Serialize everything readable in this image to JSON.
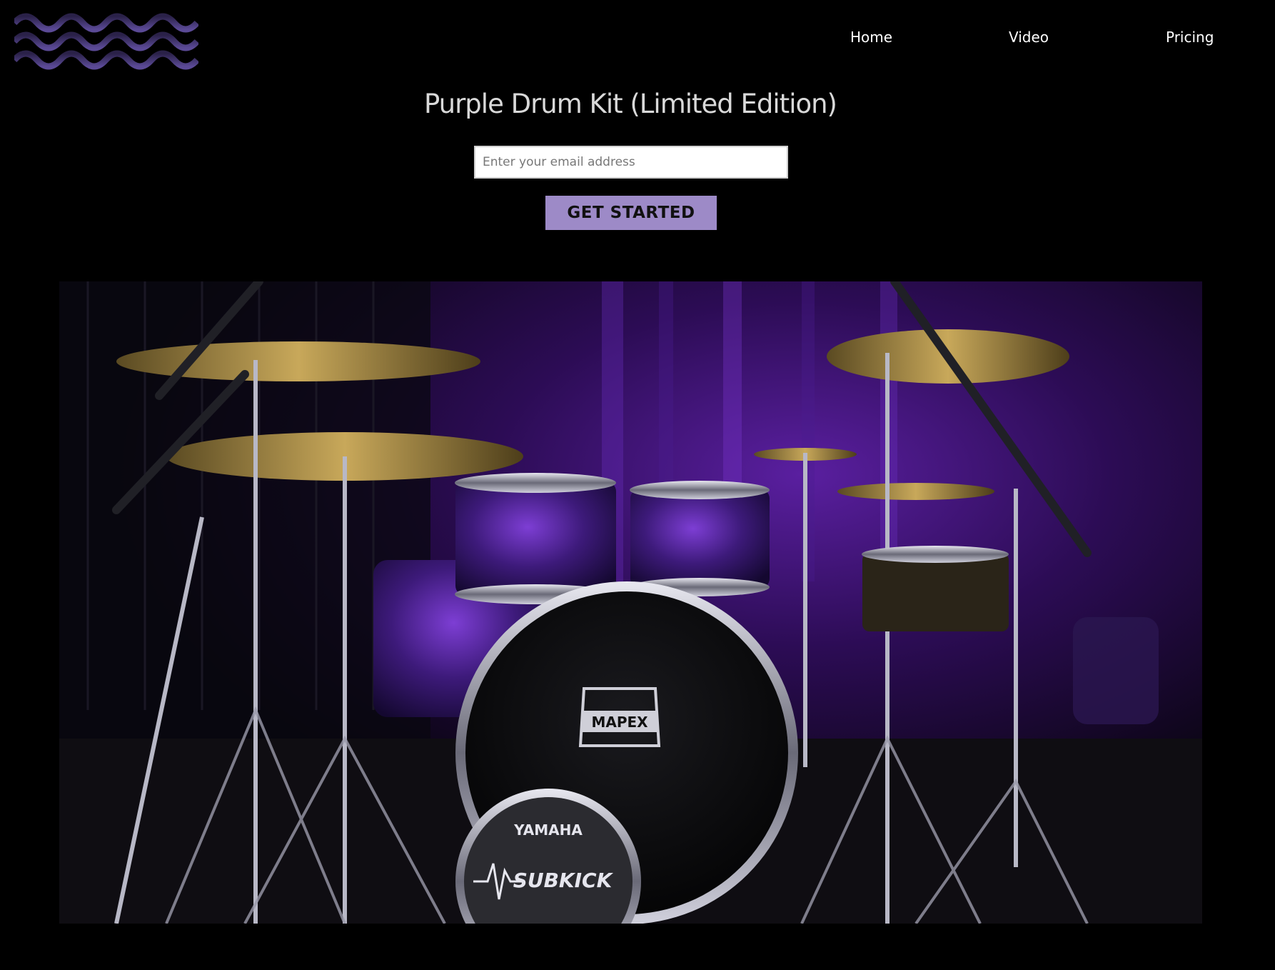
{
  "header": {
    "logo_icon": "waves-logo-icon",
    "nav": {
      "home": "Home",
      "video": "Video",
      "pricing": "Pricing"
    }
  },
  "hero": {
    "title": "Purple Drum Kit (Limited Edition)",
    "email_placeholder": "Enter your email address",
    "cta_label": "GET STARTED"
  },
  "photo": {
    "subject": "drum-kit-photo",
    "brand_bass_drum": "MAPEX",
    "brand_subkick": "YAMAHA",
    "subkick_label": "SUBKICK"
  },
  "colors": {
    "background": "#000000",
    "accent": "#9d8ac7",
    "logo_wave": "#4a3a7a",
    "title_text": "#d9d9d9"
  }
}
